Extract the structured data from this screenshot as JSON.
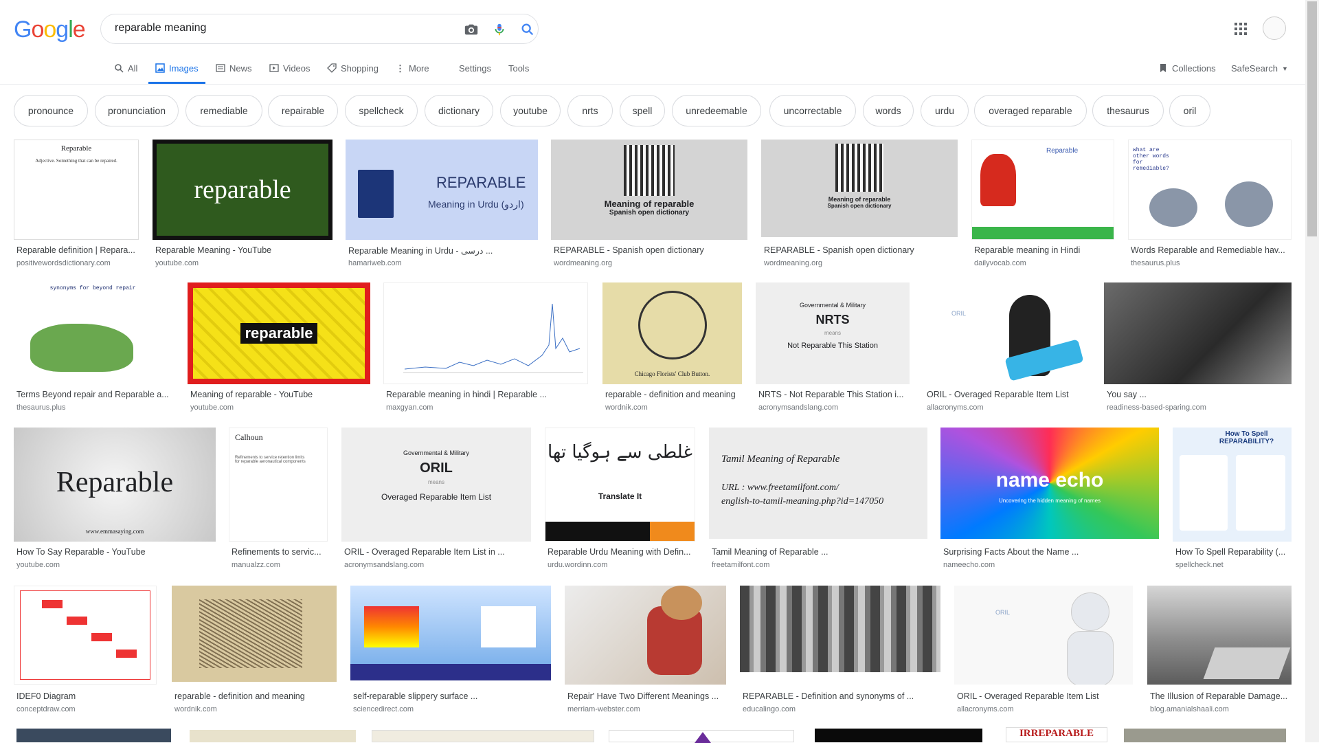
{
  "logo": {
    "letters": [
      "G",
      "o",
      "o",
      "g",
      "l",
      "e"
    ],
    "colors": [
      "#4285F4",
      "#EA4335",
      "#FBBC05",
      "#4285F4",
      "#34A853",
      "#EA4335"
    ]
  },
  "search": {
    "query": "reparable meaning"
  },
  "tabs": {
    "all": "All",
    "images": "Images",
    "news": "News",
    "videos": "Videos",
    "shopping": "Shopping",
    "more": "More",
    "settings": "Settings",
    "tools": "Tools",
    "collections": "Collections",
    "safesearch": "SafeSearch"
  },
  "chips": [
    "pronounce",
    "pronunciation",
    "remediable",
    "repairable",
    "spellcheck",
    "dictionary",
    "youtube",
    "nrts",
    "spell",
    "unredeemable",
    "uncorrectable",
    "words",
    "urdu",
    "overaged reparable",
    "thesaurus",
    "oril"
  ],
  "results": [
    {
      "title": "Reparable definition | Repara...",
      "source": "positivewordsdictionary.com",
      "thumb_text": "Reparable"
    },
    {
      "title": "Reparable Meaning - YouTube",
      "source": "youtube.com",
      "thumb_text": "reparable"
    },
    {
      "title": "Reparable Meaning in Urdu - درسی ...",
      "source": "hamariweb.com",
      "thumb_text": "REPARABLE"
    },
    {
      "title": "REPARABLE - Spanish open dictionary",
      "source": "wordmeaning.org",
      "thumb_text": "Meaning of reparable"
    },
    {
      "title": "REPARABLE - Spanish open dictionary",
      "source": "wordmeaning.org",
      "thumb_text": "Meaning of reparable"
    },
    {
      "title": "Reparable meaning in Hindi",
      "source": "dailyvocab.com",
      "thumb_text": "Reparable"
    },
    {
      "title": "Words Reparable and Remediable hav...",
      "source": "thesaurus.plus",
      "thumb_text": "what are other words for remediable?"
    },
    {
      "title": "Terms Beyond repair and Reparable a...",
      "source": "thesaurus.plus",
      "thumb_text": "synonyms for beyond repair"
    },
    {
      "title": "Meaning of reparable - YouTube",
      "source": "youtube.com",
      "thumb_text": "reparable"
    },
    {
      "title": "Reparable meaning in hindi | Reparable ...",
      "source": "maxgyan.com",
      "thumb_text": ""
    },
    {
      "title": "reparable - definition and meaning",
      "source": "wordnik.com",
      "thumb_text": "Chicago Florists' Club Button."
    },
    {
      "title": "NRTS - Not Reparable This Station i...",
      "source": "acronymsandslang.com",
      "thumb_text": "NRTS"
    },
    {
      "title": "ORIL - Overaged Reparable Item List",
      "source": "allacronyms.com",
      "thumb_text": "ORIL"
    },
    {
      "title": "You say ...",
      "source": "readiness-based-sparing.com",
      "thumb_text": ""
    },
    {
      "title": "How To Say Reparable - YouTube",
      "source": "youtube.com",
      "thumb_text": "Reparable"
    },
    {
      "title": "Refinements to servic...",
      "source": "manualzz.com",
      "thumb_text": "Calhoun"
    },
    {
      "title": "ORIL - Overaged Reparable Item List in ...",
      "source": "acronymsandslang.com",
      "thumb_text": "ORIL"
    },
    {
      "title": "Reparable Urdu Meaning with Defin...",
      "source": "urdu.wordinn.com",
      "thumb_text": "Translate It"
    },
    {
      "title": "Tamil Meaning of Reparable ...",
      "source": "freetamilfont.com",
      "thumb_text": "Tamil Meaning of Reparable"
    },
    {
      "title": "Surprising Facts About the Name ...",
      "source": "nameecho.com",
      "thumb_text": "name echo"
    },
    {
      "title": "How To Spell Reparability (...",
      "source": "spellcheck.net",
      "thumb_text": "How To Spell REPARABILITY?"
    },
    {
      "title": "IDEF0 Diagram",
      "source": "conceptdraw.com",
      "thumb_text": ""
    },
    {
      "title": "reparable - definition and meaning",
      "source": "wordnik.com",
      "thumb_text": ""
    },
    {
      "title": "self-reparable slippery surface ...",
      "source": "sciencedirect.com",
      "thumb_text": ""
    },
    {
      "title": "Repair' Have Two Different Meanings ...",
      "source": "merriam-webster.com",
      "thumb_text": ""
    },
    {
      "title": "REPARABLE - Definition and synonyms of ...",
      "source": "educalingo.com",
      "thumb_text": ""
    },
    {
      "title": "ORIL - Overaged Reparable Item List",
      "source": "allacronyms.com",
      "thumb_text": "ORIL"
    },
    {
      "title": "The Illusion of Reparable Damage...",
      "source": "blog.amanialshaali.com",
      "thumb_text": ""
    }
  ],
  "partial_row_text": "IRREPARABLE"
}
